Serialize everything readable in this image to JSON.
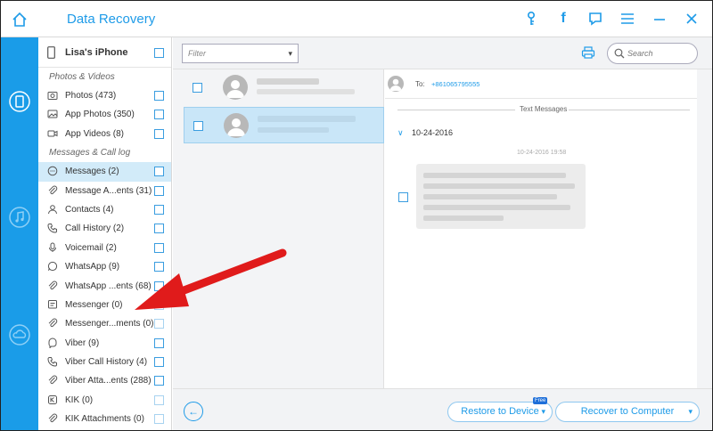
{
  "app": {
    "title": "Data Recovery"
  },
  "device": {
    "name": "Lisa's iPhone"
  },
  "sidebar": {
    "groups": [
      {
        "label": "Photos & Videos"
      },
      {
        "label": "Messages & Call log"
      }
    ],
    "photos": [
      {
        "label": "Photos (473)",
        "icon": "photo-icon"
      },
      {
        "label": "App Photos (350)",
        "icon": "app-photo-icon"
      },
      {
        "label": "App Videos (8)",
        "icon": "video-icon"
      }
    ],
    "messages": [
      {
        "label": "Messages (2)",
        "icon": "chat-icon"
      },
      {
        "label": "Message A...ents (31)",
        "icon": "attachment-icon"
      },
      {
        "label": "Contacts (4)",
        "icon": "contact-icon"
      },
      {
        "label": "Call History (2)",
        "icon": "phone-icon"
      },
      {
        "label": "Voicemail (2)",
        "icon": "mic-icon"
      },
      {
        "label": "WhatsApp (9)",
        "icon": "whatsapp-icon"
      },
      {
        "label": "WhatsApp ...ents (68)",
        "icon": "attachment-icon"
      },
      {
        "label": "Messenger (0)",
        "icon": "messenger-icon"
      },
      {
        "label": "Messenger...ments (0)",
        "icon": "attachment-icon"
      },
      {
        "label": "Viber (9)",
        "icon": "viber-icon"
      },
      {
        "label": "Viber Call History (4)",
        "icon": "phone-icon"
      },
      {
        "label": "Viber Atta...ents (288)",
        "icon": "attachment-icon"
      },
      {
        "label": "KIK (0)",
        "icon": "kik-icon"
      },
      {
        "label": "KIK Attachments (0)",
        "icon": "attachment-icon"
      }
    ]
  },
  "toolbar": {
    "filter_placeholder": "Filter",
    "search_placeholder": "Search"
  },
  "detail": {
    "to_label": "To:",
    "to_number": "+861065795555",
    "section_label": "Text Messages",
    "date": "10-24-2016",
    "timestamp": "10-24-2016 19:58"
  },
  "footer": {
    "restore_label": "Restore to Device",
    "free_badge": "Free",
    "recover_label": "Recover to Computer"
  },
  "colors": {
    "accent": "#1e9be8",
    "rail": "#1a9ce8",
    "selection": "#d2ebf9",
    "annotation_arrow": "#e01b1b"
  }
}
